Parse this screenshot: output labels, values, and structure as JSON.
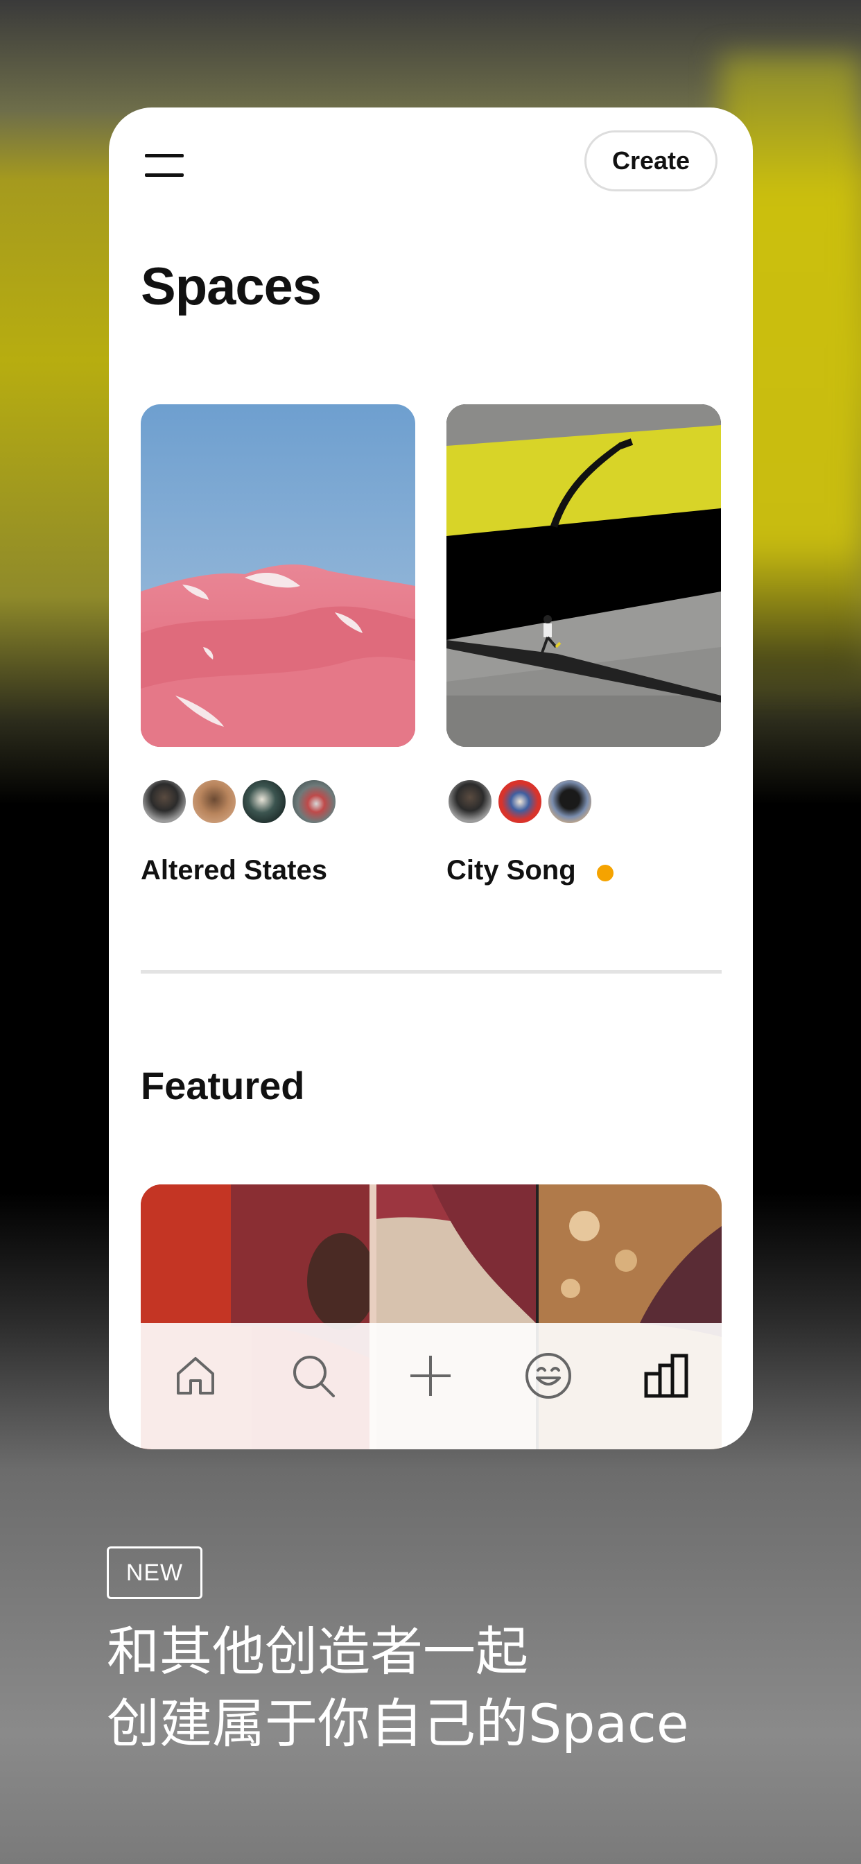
{
  "header": {
    "create_label": "Create"
  },
  "page_title": "Spaces",
  "spaces": [
    {
      "name": "Altered States",
      "avatar_count": 4,
      "unread": false
    },
    {
      "name": "City Song",
      "avatar_count": 3,
      "unread": true
    }
  ],
  "featured": {
    "title": "Featured"
  },
  "tabbar": {
    "items": [
      {
        "icon": "home-icon",
        "active": false
      },
      {
        "icon": "search-icon",
        "active": false
      },
      {
        "icon": "plus-icon",
        "active": false
      },
      {
        "icon": "smiley-icon",
        "active": false
      },
      {
        "icon": "spaces-icon",
        "active": true
      }
    ]
  },
  "promo": {
    "badge": "NEW",
    "line1": "和其他创造者一起",
    "line2": "创建属于你自己的Space"
  },
  "colors": {
    "unread_dot": "#f5a300",
    "background_accent": "#b7ad10"
  }
}
